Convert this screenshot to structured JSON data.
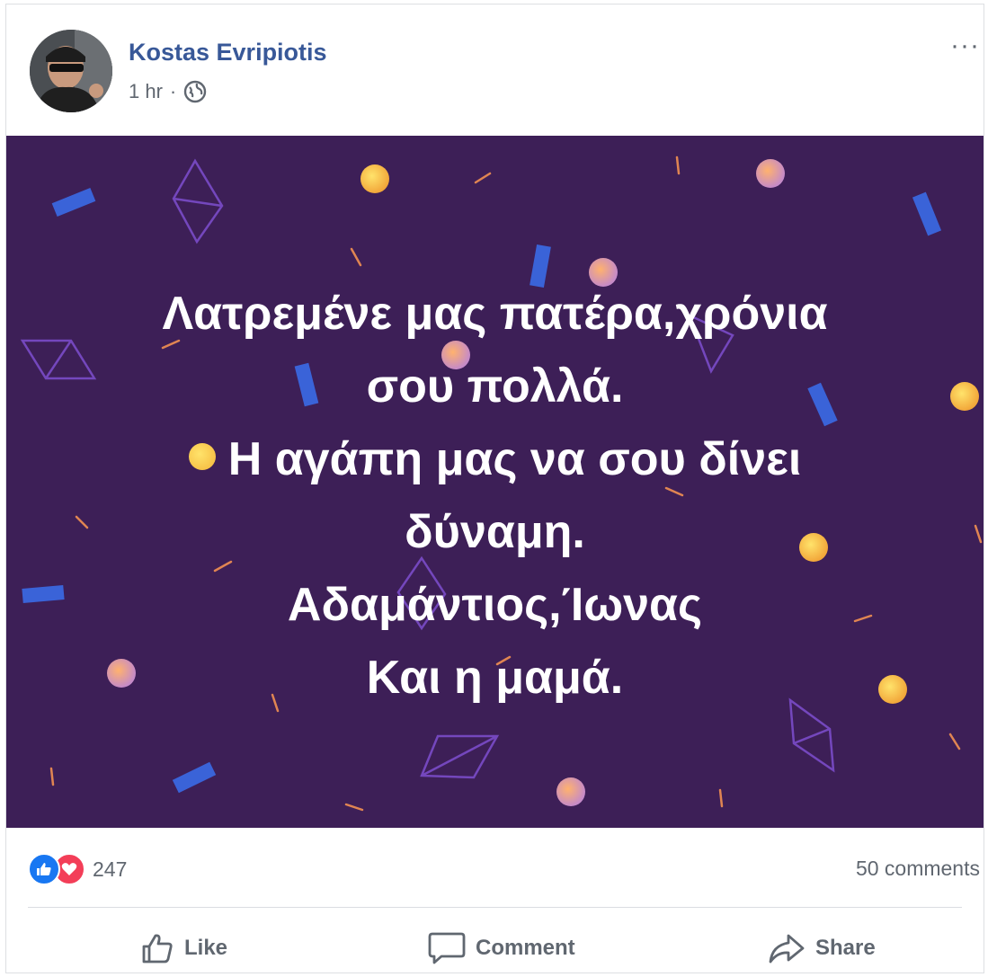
{
  "post": {
    "author": "Kostas Evripiotis",
    "time": "1 hr",
    "separator": "·",
    "privacy_icon": "globe-icon",
    "more_label": "···"
  },
  "image_text": {
    "line1": "Λατρεμένε μας πατέρα,χρόνια",
    "line2": "σου πολλά.",
    "line3": "Η αγάπη μας να σου δίνει",
    "line4": "δύναμη.",
    "line5": "Αδαμάντιος,Ίωνας",
    "line6": "Και η μαμά."
  },
  "stats": {
    "reaction_count": "247",
    "comments": "50 comments"
  },
  "actions": {
    "like": "Like",
    "comment": "Comment",
    "share": "Share"
  },
  "colors": {
    "author": "#385898",
    "image_bg": "#3d1f57",
    "like": "#1877f2",
    "love": "#f33e58"
  }
}
